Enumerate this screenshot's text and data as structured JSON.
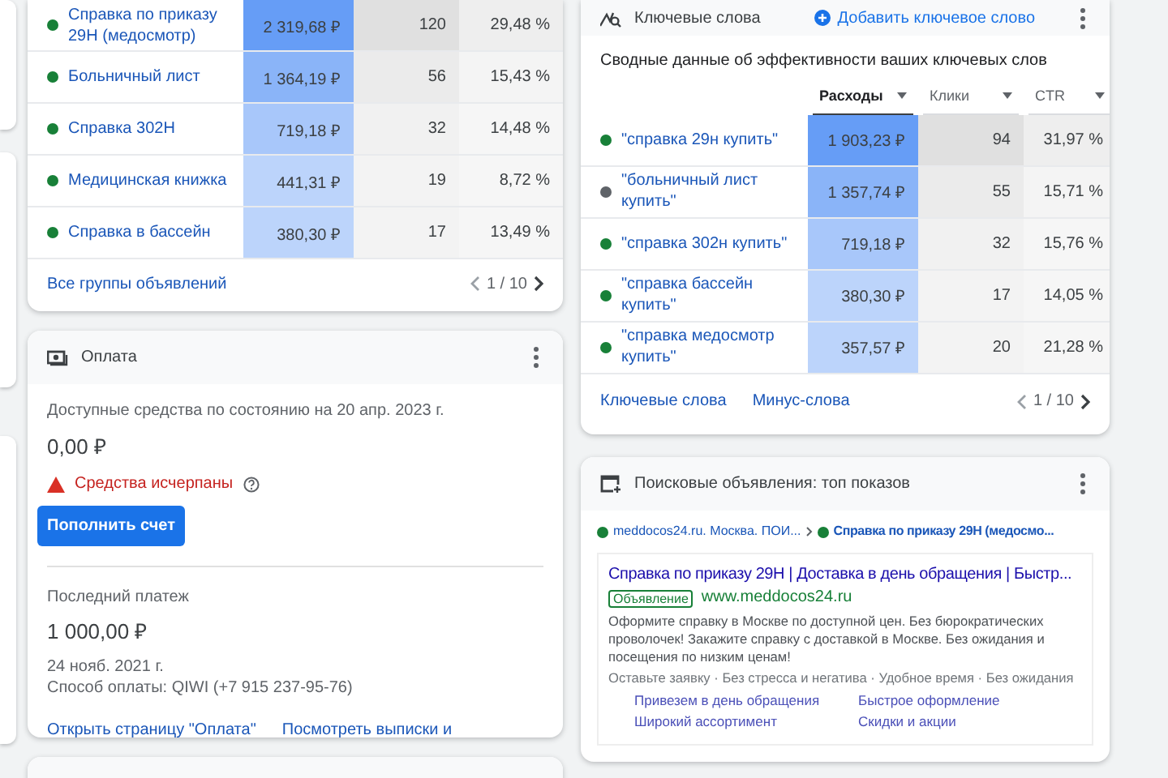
{
  "ad_groups": {
    "rows": [
      {
        "name": "Справка по приказу 29Н (медосмотр)",
        "color": "#188038",
        "spend": "2 319,68 ₽",
        "clicks": "120",
        "ctr": "29,48 %"
      },
      {
        "name": "Больничный лист",
        "color": "#188038",
        "spend": "1 364,19 ₽",
        "clicks": "56",
        "ctr": "15,43 %"
      },
      {
        "name": "Справка 302Н",
        "color": "#188038",
        "spend": "719,18 ₽",
        "clicks": "32",
        "ctr": "14,48 %"
      },
      {
        "name": "Медицинская книжка",
        "color": "#188038",
        "spend": "441,31 ₽",
        "clicks": "19",
        "ctr": "8,72 %"
      },
      {
        "name": "Справка в бассейн",
        "color": "#188038",
        "spend": "380,30 ₽",
        "clicks": "17",
        "ctr": "13,49 %"
      }
    ],
    "footer_link": "Все группы объявлений",
    "pager": "1 / 10"
  },
  "payment": {
    "title": "Оплата",
    "available_label": "Доступные средства по состоянию на 20 апр. 2023 г.",
    "balance": "0,00 ₽",
    "warning": "Средства исчерпаны",
    "button": "Пополнить счет",
    "last_label": "Последний платеж",
    "last_amount": "1 000,00 ₽",
    "last_date": "24 нояб. 2021 г.",
    "method": "Способ оплаты: QIWI (+7 915 237-95-76)",
    "links": [
      "Открыть страницу \"Оплата\"",
      "Посмотреть выписки и"
    ]
  },
  "keywords": {
    "title": "Ключевые слова",
    "add": "Добавить ключевое слово",
    "subtitle": "Сводные данные об эффективности ваших ключевых слов",
    "columns": [
      {
        "label": "Расходы",
        "selected": true
      },
      {
        "label": "Клики",
        "selected": false
      },
      {
        "label": "CTR",
        "selected": false
      }
    ],
    "rows": [
      {
        "name": "\"справка 29н купить\"",
        "color": "#188038",
        "spend": "1 903,23 ₽",
        "clicks": "94",
        "ctr": "31,97 %"
      },
      {
        "name": "\"больничный лист купить\"",
        "color": "#5f6368",
        "spend": "1 357,74 ₽",
        "clicks": "55",
        "ctr": "15,71 %"
      },
      {
        "name": "\"справка 302н купить\"",
        "color": "#188038",
        "spend": "719,18 ₽",
        "clicks": "32",
        "ctr": "15,76 %"
      },
      {
        "name": "\"справка бассейн купить\"",
        "color": "#188038",
        "spend": "380,30 ₽",
        "clicks": "17",
        "ctr": "14,05 %"
      },
      {
        "name": "\"справка медосмотр купить\"",
        "color": "#188038",
        "spend": "357,57 ₽",
        "clicks": "20",
        "ctr": "21,28 %"
      }
    ],
    "links": [
      "Ключевые слова",
      "Минус-слова"
    ],
    "pager": "1 / 10"
  },
  "search_ads": {
    "title": "Поисковые объявления: топ показов",
    "crumbs": [
      "meddocos24.ru. Москва. ПОИ...",
      "Справка по приказу 29Н (медосмо..."
    ],
    "headline": "Справка по приказу 29Н | Доставка в день обращения | Быстр...",
    "ad_badge": "Объявление",
    "url": "www.meddocos24.ru",
    "description": "Оформите справку в Москве по доступной цен. Без бюрократических проволочек! Закажите справку с доставкой в Москве. Без ожидания и посещения по низким ценам!",
    "callouts": "Оставьте заявку · Без стресса и негатива · Удобное время · Без ожидания",
    "sitelinks": [
      "Привезем в день обращения",
      "Быстрое оформление",
      "Широкий ассортимент",
      "Скидки и акции"
    ]
  }
}
